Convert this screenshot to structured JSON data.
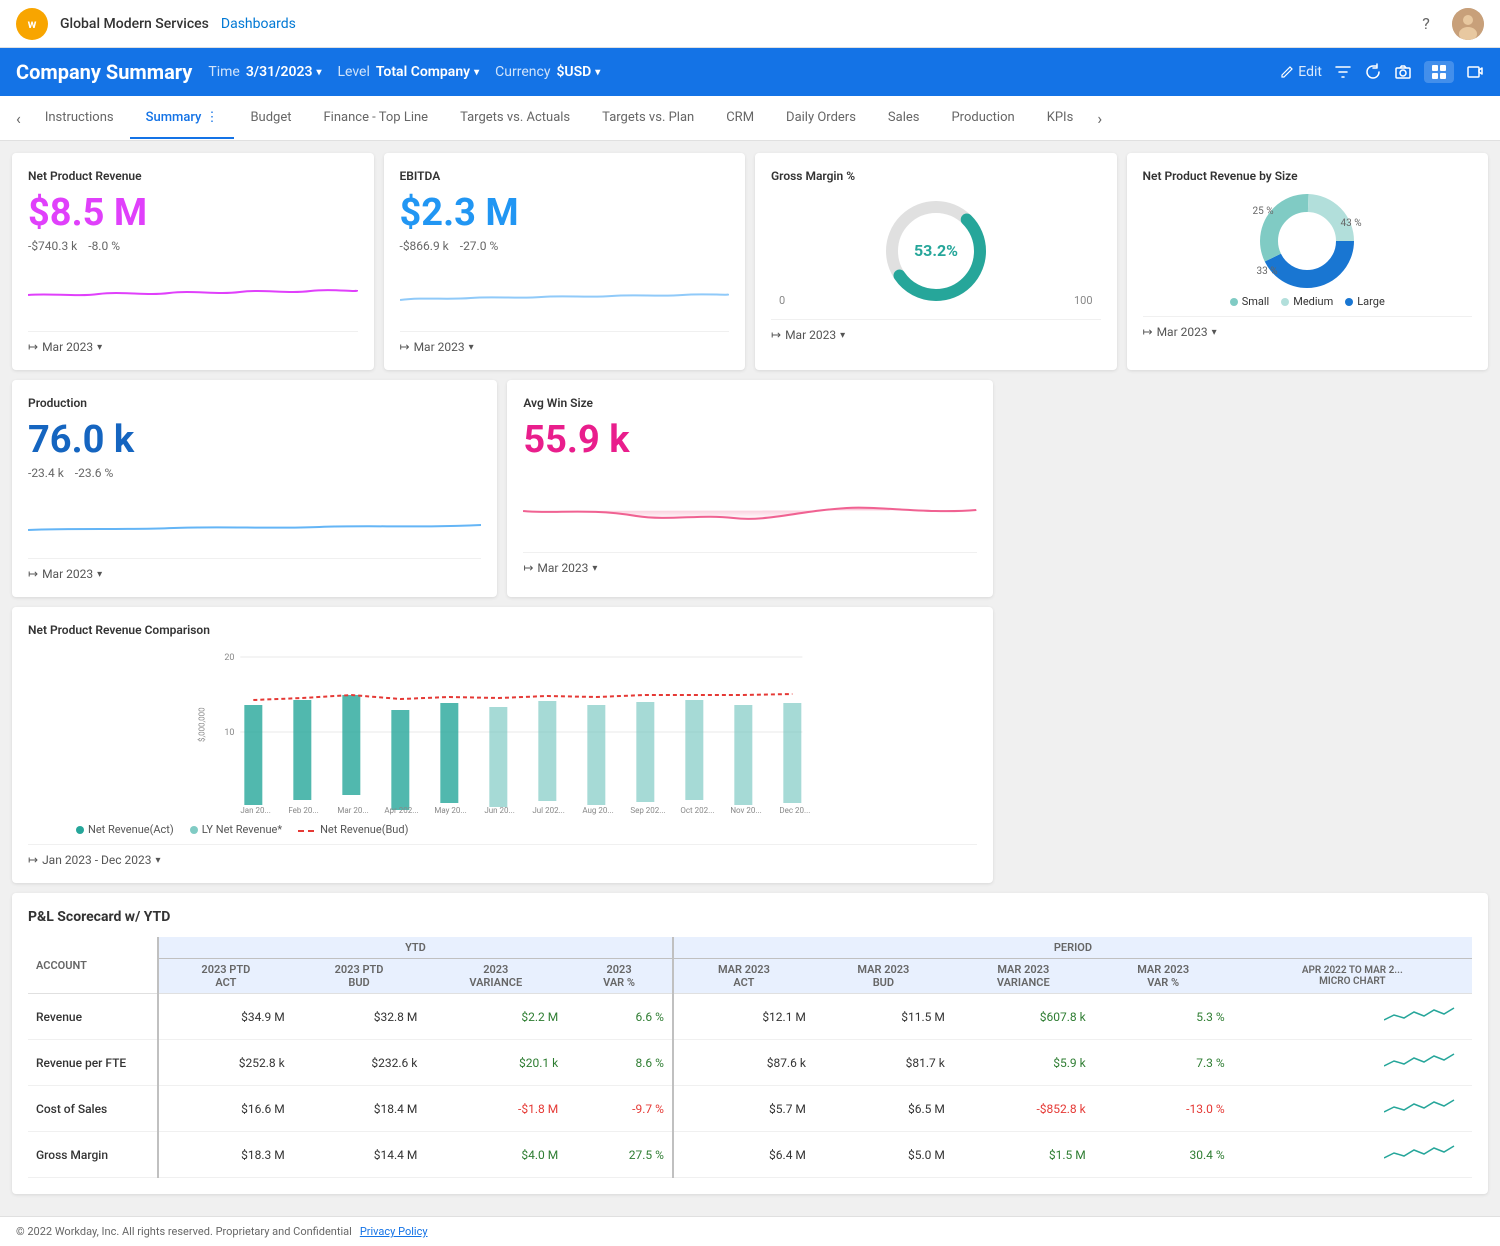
{
  "topnav": {
    "logo_letter": "w",
    "company": "Global Modern Services",
    "dashboards": "Dashboards"
  },
  "header": {
    "title": "Company Summary",
    "time_label": "Time",
    "time_value": "3/31/2023",
    "level_label": "Level",
    "level_value": "Total Company",
    "currency_label": "Currency",
    "currency_value": "$USD",
    "edit_label": "Edit"
  },
  "tabs": {
    "items": [
      {
        "label": "Instructions",
        "active": false
      },
      {
        "label": "Summary",
        "active": true
      },
      {
        "label": "Budget",
        "active": false
      },
      {
        "label": "Finance - Top Line",
        "active": false
      },
      {
        "label": "Targets vs. Actuals",
        "active": false
      },
      {
        "label": "Targets vs. Plan",
        "active": false
      },
      {
        "label": "CRM",
        "active": false
      },
      {
        "label": "Daily Orders",
        "active": false
      },
      {
        "label": "Sales",
        "active": false
      },
      {
        "label": "Production",
        "active": false
      },
      {
        "label": "KPIs",
        "active": false
      }
    ]
  },
  "cards": {
    "net_product_revenue": {
      "title": "Net Product Revenue",
      "value": "$8.5 M",
      "delta1": "-$740.3 k",
      "delta2": "-8.0 %",
      "period": "Mar 2023"
    },
    "ebitda": {
      "title": "EBITDA",
      "value": "$2.3 M",
      "delta1": "-$866.9 k",
      "delta2": "-27.0 %",
      "period": "Mar 2023"
    },
    "gross_margin": {
      "title": "Gross Margin %",
      "value": "53.2%",
      "min": "0",
      "max": "100",
      "period": "Mar 2023"
    },
    "net_product_revenue_by_size": {
      "title": "Net Product Revenue by Size",
      "small_pct": "33 %",
      "medium_pct": "25 %",
      "large_pct": "43 %",
      "legend_small": "Small",
      "legend_medium": "Medium",
      "legend_large": "Large",
      "period": "Mar 2023"
    },
    "production": {
      "title": "Production",
      "value": "76.0 k",
      "delta1": "-23.4 k",
      "delta2": "-23.6 %",
      "period": "Mar 2023"
    },
    "avg_win_size": {
      "title": "Avg Win Size",
      "value": "55.9 k",
      "period": "Mar 2023"
    },
    "net_product_revenue_comparison": {
      "title": "Net Product Revenue Comparison",
      "y_label": "$,000,000",
      "y_max": "20",
      "y_mid": "10",
      "period": "Jan 2023 - Dec 2023",
      "legend_act": "Net Revenue(Act)",
      "legend_ly": "LY Net Revenue*",
      "legend_bud": "Net Revenue(Bud)",
      "months": [
        "Jan 20...",
        "Feb 20...",
        "Mar 20...",
        "Apr 202...",
        "May 20...",
        "Jun 20...",
        "Jul 202...",
        "Aug 20...",
        "Sep 202...",
        "Oct 202...",
        "Nov 20...",
        "Dec 20..."
      ]
    }
  },
  "pl_scorecard": {
    "title": "P&L Scorecard w/ YTD",
    "col_headers": {
      "account": "ACCOUNT",
      "ytd_act": "2023 PTD\nACT",
      "ytd_bud": "2023 PTD\nBUD",
      "ytd_var": "2023\nVARIANCE",
      "ytd_var_pct": "2023\nVAR %",
      "mar_act": "MAR 2023\nACT",
      "mar_bud": "MAR 2023\nBUD",
      "mar_var": "MAR 2023\nVARIANCE",
      "mar_var_pct": "MAR 2023\nVAR %",
      "micro": "APR 2022 TO MAR 2...\nMICRO CHART"
    },
    "group_labels": {
      "ytd": "YTD",
      "period": "PERIOD"
    },
    "rows": [
      {
        "account": "Revenue",
        "ytd_act": "$34.9 M",
        "ytd_bud": "$32.8 M",
        "ytd_var": "$2.2 M",
        "ytd_var_pct": "6.6 %",
        "mar_act": "$12.1 M",
        "mar_bud": "$11.5 M",
        "mar_var": "$607.8 k",
        "mar_var_pct": "5.3 %",
        "has_chart": true
      },
      {
        "account": "Revenue per FTE",
        "ytd_act": "$252.8 k",
        "ytd_bud": "$232.6 k",
        "ytd_var": "$20.1 k",
        "ytd_var_pct": "8.6 %",
        "mar_act": "$87.6 k",
        "mar_bud": "$81.7 k",
        "mar_var": "$5.9 k",
        "mar_var_pct": "7.3 %",
        "has_chart": true
      },
      {
        "account": "Cost of Sales",
        "ytd_act": "$16.6 M",
        "ytd_bud": "$18.4 M",
        "ytd_var": "-$1.8 M",
        "ytd_var_pct": "-9.7 %",
        "mar_act": "$5.7 M",
        "mar_bud": "$6.5 M",
        "mar_var": "-$852.8 k",
        "mar_var_pct": "-13.0 %",
        "has_chart": true
      },
      {
        "account": "Gross Margin",
        "ytd_act": "$18.3 M",
        "ytd_bud": "$14.4 M",
        "ytd_var": "$4.0 M",
        "ytd_var_pct": "27.5 %",
        "mar_act": "$6.4 M",
        "mar_bud": "$5.0 M",
        "mar_var": "$1.5 M",
        "mar_var_pct": "30.4 %",
        "has_chart": true
      }
    ]
  },
  "footer": {
    "copyright": "© 2022 Workday, Inc. All rights reserved. Proprietary and Confidential",
    "privacy_link": "Privacy Policy"
  }
}
